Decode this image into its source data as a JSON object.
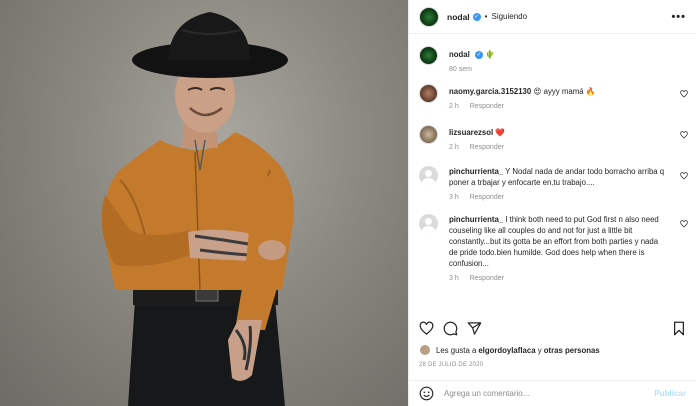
{
  "post": {
    "username": "nodal",
    "follow_status": "Siguiendo",
    "more_label": "•••",
    "verified_mark": "✓",
    "separator": "•",
    "caption_emoji": "🌵",
    "caption_age": "80 sem"
  },
  "comments": [
    {
      "user": "naomy.garcia.3152130",
      "text": " 😍 ayyy mamá 🔥",
      "time": "2 h",
      "reply": "Responder",
      "avatar": "photo"
    },
    {
      "user": "lizsuarezsol",
      "text": " ❤️",
      "time": "2 h",
      "reply": "Responder",
      "avatar": "photo"
    },
    {
      "user": "pinchurrienta_",
      "text": " Y Nodal nada de andar todo borracho arriba q poner a trbajar y enfocarte en.tu trabajo....",
      "time": "3 h",
      "reply": "Responder",
      "avatar": "placeholder"
    },
    {
      "user": "pinchurrienta_",
      "text": " I think both need to put God first n also need couseling like all couples do and not for just a little bit constantly...but its gotta be an effort from both parties y nada de pride todo.bien humilde. God does help when there is confusion...",
      "time": "3 h",
      "reply": "Responder",
      "avatar": "placeholder"
    }
  ],
  "likes": {
    "prefix": "Les gusta a ",
    "user": "elgordoylaflaca",
    "middle": " y ",
    "others": "otras personas"
  },
  "date": "28 DE JULIO DE 2020",
  "add_comment": {
    "placeholder": "Agrega un comentario...",
    "publish": "Publicar"
  },
  "icons": {
    "like": "heart-icon",
    "comment": "comment-icon",
    "share": "share-icon",
    "save": "bookmark-icon",
    "emoji": "emoji-icon",
    "verified": "verified-badge-icon"
  },
  "colors": {
    "verified": "#3897f0",
    "muted": "#8e8e8e",
    "publish": "#b2dffc",
    "border": "#efefef",
    "heart_red": "#ed4956",
    "shirt": "#c47a2c"
  }
}
